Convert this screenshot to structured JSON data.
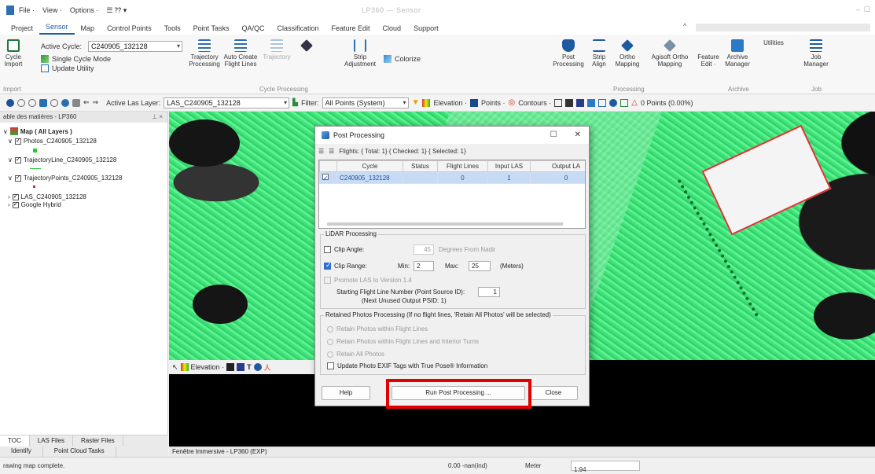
{
  "titlebar": {
    "menu": [
      "File ·",
      "View ·",
      "Options ·"
    ],
    "title": "LP360 — Sensor"
  },
  "ribbon_tabs": [
    "Project",
    "Sensor",
    "Map",
    "Control Points",
    "Tools",
    "Point Tasks",
    "QA/QC",
    "Classification",
    "Feature Edit",
    "Cloud",
    "Support"
  ],
  "ribbon": {
    "active_cycle_label": "Active Cycle:",
    "active_cycle_value": "C240905_132128",
    "single_cycle_mode": "Single Cycle Mode",
    "update_utility": "Update Utility",
    "cycle_import": "Cycle\nImport",
    "import_label": "Import",
    "trajectory_processing": "Trajectory\nProcessing",
    "auto_create_flight_lines": "Auto Create\nFlight Lines",
    "trajectory_dim": "Trajectory",
    "strip_adjustment": "Strip\nAdjustment",
    "cycle_processing": "Cycle Processing",
    "colorize": "Colorize",
    "post_processing": "Post\nProcessing",
    "strip_align": "Strip\nAlign",
    "ortho_mapping": "Ortho\nMapping",
    "agisoft_ortho_mapping": "Agisoft Ortho\nMapping",
    "feature_edit": "Feature\nEdit ·",
    "processing_label": "Processing",
    "archive_manager": "Archive\nManager",
    "archive_label": "Archive",
    "utilities": "Utilities",
    "job_manager": "Job\nManager",
    "job_label": "Job"
  },
  "toolbar": {
    "active_las_label": "Active Las Layer:",
    "active_las_value": "LAS_C240905_132128",
    "filter_label": "Filter:",
    "filter_value": "All Points (System)",
    "elevation": "Elevation ·",
    "points": "Points ·",
    "contours": "Contours ·",
    "points_count": "0 Points (0.00%)"
  },
  "toc": {
    "header": "able des matières - LP360",
    "items": [
      "Map ( All Layers )",
      "Photos_C240905_132128",
      "TrajectoryLine_C240905_132128",
      "TrajectoryPoints_C240905_132128",
      "LAS_C240905_132128",
      "Google Hybrid"
    ],
    "tabs": [
      "TOC",
      "LAS Files",
      "Raster Files"
    ],
    "bottom_tabs": [
      "Identify",
      "Point Cloud Tasks"
    ]
  },
  "immersive": {
    "elevation": "Elevation ·",
    "tab_label": "Fenêtre Immersive - LP360 (EXP)"
  },
  "statusbar": {
    "message": "rawing map complete.",
    "coords": "0.00 -nan(ind)",
    "unit": "Meter",
    "scale": "1:94"
  },
  "dialog": {
    "title": "Post Processing",
    "flights_summary": "Flights: { Total: 1} { Checked: 1} { Selected: 1}",
    "columns": [
      "Cycle",
      "Status",
      "Flight Lines",
      "Input LAS",
      "Output LA"
    ],
    "rows": [
      {
        "checked": true,
        "cycle": "C240905_132128",
        "status": "",
        "flight_lines": "0",
        "input_las": "1",
        "output_las": "0"
      }
    ],
    "lidar_section": "LiDAR Processing",
    "clip_angle_label": "Clip Angle:",
    "clip_angle_value": "45",
    "clip_angle_note": "Degrees From Nadir",
    "clip_range_label": "Clip Range:",
    "min_label": "Min:",
    "min_value": "2",
    "max_label": "Max:",
    "max_value": "25",
    "meters_label": "(Meters)",
    "promote_las": "Promote LAS to Version 1.4",
    "starting_flight_line": "Starting Flight Line Number (Point Source ID):",
    "starting_flight_line_value": "1",
    "next_unused": "(Next Unused Output PSID: 1)",
    "retained_section": "Retained Photos Processing  (If no flight lines, 'Retain All Photos' will be selected)",
    "retain_within": "Retain Photos within Flight Lines",
    "retain_within_turns": "Retain Photos within Flight Lines and Interior Turns",
    "retain_all": "Retain All Photos",
    "update_exif": "Update Photo EXIF Tags with True Pose® Information",
    "help": "Help",
    "run": "Run Post Processing ...",
    "close": "Close"
  }
}
